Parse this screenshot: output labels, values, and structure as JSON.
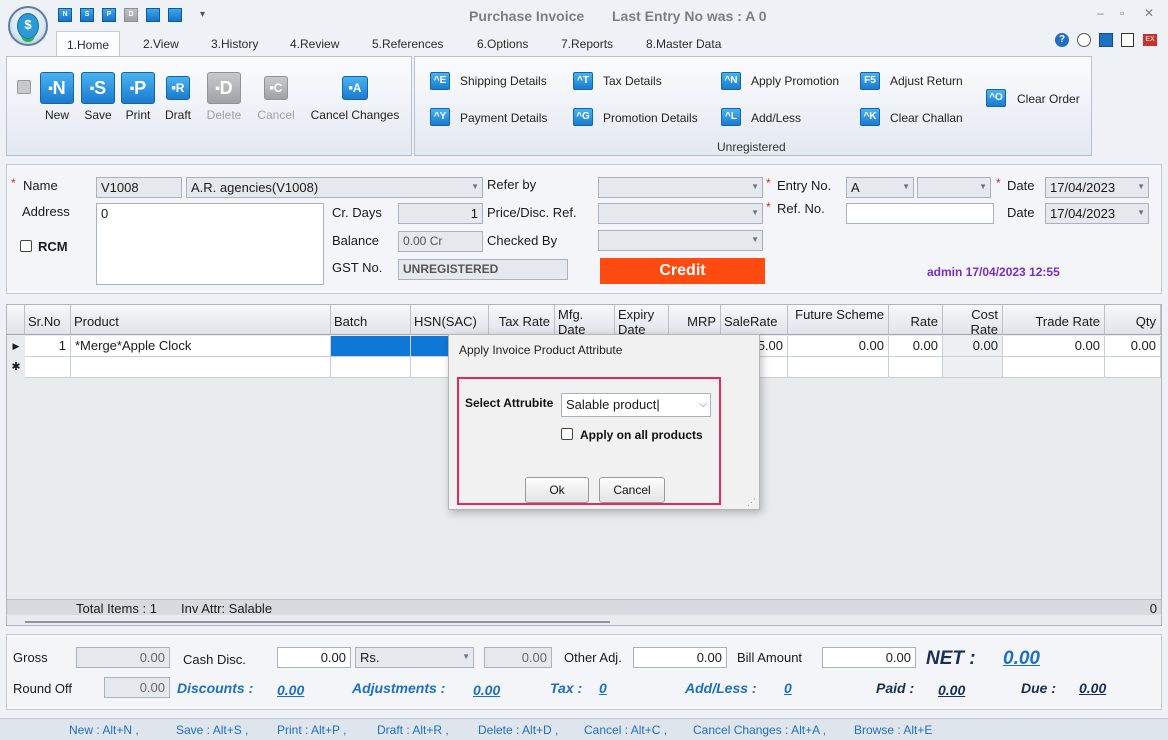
{
  "title": {
    "app_title": "Purchase Invoice",
    "last_entry": "Last Entry No was : A 0",
    "quick_access": [
      "N",
      "S",
      "P",
      "D"
    ]
  },
  "tabs": [
    "1.Home",
    "2.View",
    "3.History",
    "4.Review",
    "5.References",
    "6.Options",
    "7.Reports",
    "8.Master Data"
  ],
  "ribbon": {
    "big_buttons": [
      {
        "glyph": "N",
        "label": "New"
      },
      {
        "glyph": "S",
        "label": "Save"
      },
      {
        "glyph": "P",
        "label": "Print"
      },
      {
        "glyph": "R",
        "label": "Draft"
      },
      {
        "glyph": "D",
        "label": "Delete"
      },
      {
        "glyph": "C",
        "label": "Cancel"
      },
      {
        "glyph": "A",
        "label": "Cancel Changes"
      }
    ],
    "small_buttons": [
      {
        "glyph": "^E",
        "label": "Shipping Details"
      },
      {
        "glyph": "^Y",
        "label": "Payment Details"
      },
      {
        "glyph": "^T",
        "label": "Tax Details"
      },
      {
        "glyph": "^G",
        "label": "Promotion Details"
      },
      {
        "glyph": "^N",
        "label": "Apply Promotion"
      },
      {
        "glyph": "^L",
        "label": "Add/Less"
      },
      {
        "glyph": "F5",
        "label": "Adjust Return"
      },
      {
        "glyph": "^K",
        "label": "Clear Challan"
      },
      {
        "glyph": "^O",
        "label": "Clear Order"
      }
    ],
    "group_label": "Unregistered"
  },
  "form": {
    "name_label": "Name",
    "name_code": "V1008",
    "name_value": "A.R. agencies(V1008)",
    "address_label": "Address",
    "address_value": "0",
    "rcm_label": "RCM",
    "crdays_label": "Cr. Days",
    "crdays_value": "1",
    "balance_label": "Balance",
    "balance_value": "0.00 Cr",
    "gst_label": "GST No.",
    "gst_value": "UNREGISTERED",
    "referby_label": "Refer by",
    "pricedisc_label": "Price/Disc. Ref.",
    "checkedby_label": "Checked By",
    "credit_label": "Credit",
    "credit_color": "#ff4a10",
    "entryno_label": "Entry No.",
    "entryno_series": "A",
    "refno_label": "Ref. No.",
    "date_label": "Date",
    "date1": "17/04/2023",
    "date2_label": "Date",
    "date2": "17/04/2023",
    "admin_info": "admin 17/04/2023 12:55"
  },
  "grid": {
    "headers": [
      "Sr.No",
      "Product",
      "Batch",
      "HSN(SAC)",
      "Tax Rate",
      "Mfg. Date",
      "Expiry Date",
      "MRP",
      "SaleRate",
      "Future Scheme",
      "Rate",
      "Cost Rate",
      "Trade Rate",
      "Qty"
    ],
    "row": {
      "sr": "1",
      "product": "*Merge*Apple Clock",
      "salerate_tail": "5.00",
      "future": "0.00",
      "rate": "0.00",
      "cost": "0.00",
      "trade": "0.00",
      "qty": "0.00"
    },
    "footer_total": "Total Items : 1",
    "footer_attr": "Inv Attr: Salable",
    "footer_qty": "0"
  },
  "bottom": {
    "gross_label": "Gross",
    "gross_value": "0.00",
    "cashdisc_label": "Cash Disc.",
    "cashdisc_value": "0.00",
    "cashdisc_unit": "Rs.",
    "cashdisc_amount": "0.00",
    "otheradj_label": "Other Adj.",
    "otheradj_value": "0.00",
    "billamount_label": "Bill Amount",
    "billamount_value": "0.00",
    "net_label": "NET :",
    "net_value": "0.00",
    "roundoff_label": "Round Off",
    "roundoff_value": "0.00",
    "discounts_label": "Discounts :",
    "discounts_value": "0.00",
    "adjustments_label": "Adjustments :",
    "adjustments_value": "0.00",
    "tax_label": "Tax :",
    "tax_value": "0",
    "addless_label": "Add/Less :",
    "addless_value": "0",
    "paid_label": "Paid :",
    "paid_value": "0.00",
    "due_label": "Due :",
    "due_value": "0.00"
  },
  "status_bar": [
    "New : Alt+N ,",
    "Save : Alt+S ,",
    "Print : Alt+P ,",
    "Draft : Alt+R ,",
    "Delete : Alt+D ,",
    "Cancel : Alt+C ,",
    "Cancel Changes : Alt+A ,",
    "Browse : Alt+E"
  ],
  "dialog": {
    "title": "Apply Invoice Product Attribute",
    "select_label": "Select Attrubite",
    "select_value": "Salable product",
    "checkbox_label": "Apply on all products",
    "ok_label": "Ok",
    "cancel_label": "Cancel"
  }
}
